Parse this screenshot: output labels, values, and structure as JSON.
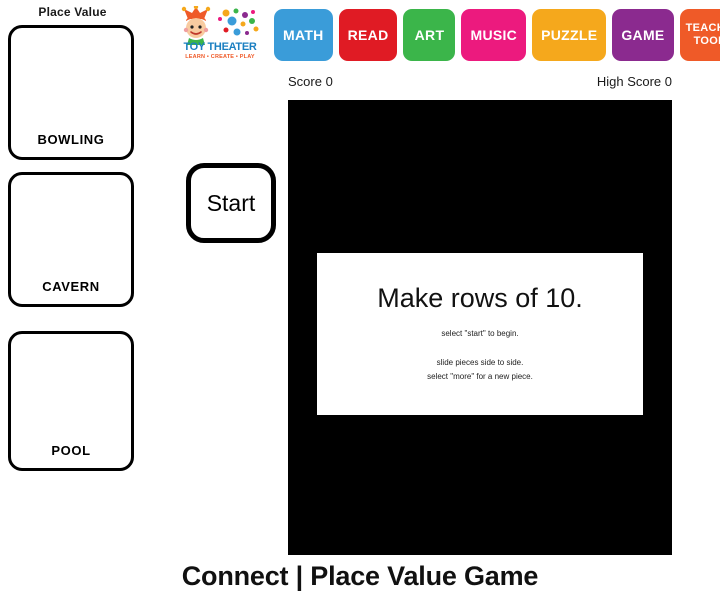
{
  "sidebar": {
    "heading": "Place Value",
    "cards": [
      {
        "label": "BOWLING"
      },
      {
        "label": "CAVERN"
      },
      {
        "label": "POOL"
      }
    ]
  },
  "topnav": {
    "logo": {
      "icon": "jester-logo-icon",
      "wordmark": "TOY THEATER",
      "tagline": "LEARN • CREATE • PLAY",
      "wordmark_color": "#1a7fc1",
      "tagline_color": "#ef5a28"
    },
    "buttons": [
      {
        "label": "MATH",
        "color": "#3a9cd9",
        "lines": 1
      },
      {
        "label": "READ",
        "color": "#e01b24",
        "lines": 1
      },
      {
        "label": "ART",
        "color": "#3bb54a",
        "lines": 1
      },
      {
        "label": "MUSIC",
        "color": "#ec1a7e",
        "lines": 1
      },
      {
        "label": "PUZZLE",
        "color": "#f5a81c",
        "lines": 1
      },
      {
        "label": "GAME",
        "color": "#8b2a8f",
        "lines": 1
      },
      {
        "label": "TEACHER TOOLS",
        "color": "#ef5a28",
        "lines": 2
      }
    ]
  },
  "scorebar": {
    "score": "Score 0",
    "high_score": "High Score 0"
  },
  "controls": {
    "start_label": "Start"
  },
  "stage": {
    "background_color": "#000000",
    "message": {
      "title": "Make rows of 10.",
      "line_1": "select \"start\" to begin.",
      "line_2": "slide pieces side to side.",
      "line_3": "select \"more\" for a new piece."
    }
  },
  "footer": {
    "title": "Connect | Place Value Game"
  }
}
